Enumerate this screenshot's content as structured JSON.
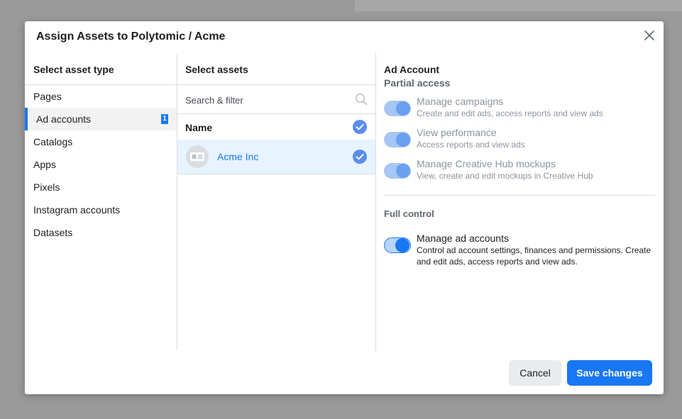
{
  "modal": {
    "title": "Assign Assets to Polytomic / Acme"
  },
  "asset_types": {
    "header": "Select asset type",
    "items": [
      {
        "label": "Pages"
      },
      {
        "label": "Ad accounts",
        "badge": "1"
      },
      {
        "label": "Catalogs"
      },
      {
        "label": "Apps"
      },
      {
        "label": "Pixels"
      },
      {
        "label": "Instagram accounts"
      },
      {
        "label": "Datasets"
      }
    ],
    "selected": "Ad accounts"
  },
  "assets": {
    "header": "Select assets",
    "search_placeholder": "Search & filter",
    "column_header": "Name",
    "rows": [
      {
        "name": "Acme Inc",
        "checked": true
      }
    ]
  },
  "permissions": {
    "section_title": "Ad Account",
    "partial_title": "Partial access",
    "partial_items": [
      {
        "title": "Manage campaigns",
        "description": "Create and edit ads, access reports and view ads",
        "enabled": true
      },
      {
        "title": "View performance",
        "description": "Access reports and view ads",
        "enabled": true
      },
      {
        "title": "Manage Creative Hub mockups",
        "description": "View, create and edit mockups in Creative Hub",
        "enabled": true
      }
    ],
    "full_title": "Full control",
    "full_item": {
      "title": "Manage ad accounts",
      "description": "Control ad account settings, finances and permissions. Create and edit ads, access reports and view ads.",
      "enabled": true
    }
  },
  "footer": {
    "cancel_label": "Cancel",
    "save_label": "Save changes"
  },
  "colors": {
    "accent": "#1877f2",
    "selected_row": "#e7f3ff",
    "overlay": "#9a9a9a"
  }
}
